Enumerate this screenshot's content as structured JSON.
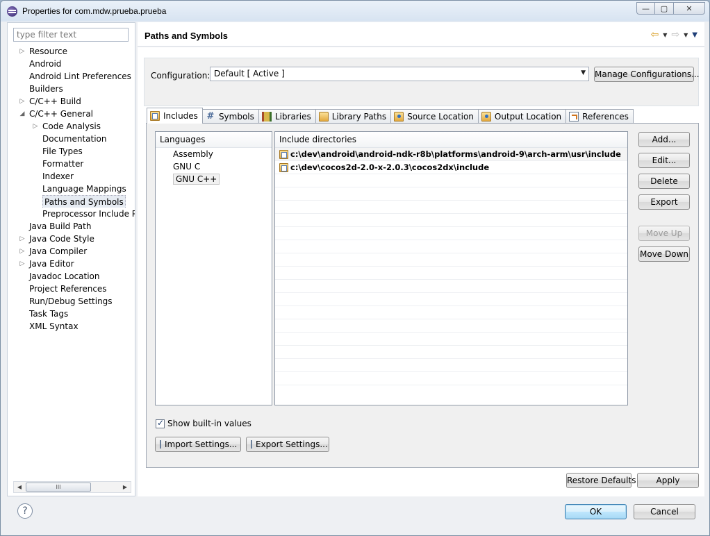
{
  "window": {
    "title": "Properties for com.mdw.prueba.prueba",
    "min_glyph": "—",
    "max_glyph": "▢",
    "close_glyph": "✕"
  },
  "filter": {
    "placeholder": "type filter text"
  },
  "tree": [
    {
      "label": "Resource",
      "level": 0,
      "twisty": "closed"
    },
    {
      "label": "Android",
      "level": 0,
      "twisty": "none"
    },
    {
      "label": "Android Lint Preferences",
      "level": 0,
      "twisty": "none"
    },
    {
      "label": "Builders",
      "level": 0,
      "twisty": "none"
    },
    {
      "label": "C/C++ Build",
      "level": 0,
      "twisty": "closed"
    },
    {
      "label": "C/C++ General",
      "level": 0,
      "twisty": "open"
    },
    {
      "label": "Code Analysis",
      "level": 1,
      "twisty": "closed"
    },
    {
      "label": "Documentation",
      "level": 1,
      "twisty": "none"
    },
    {
      "label": "File Types",
      "level": 1,
      "twisty": "none"
    },
    {
      "label": "Formatter",
      "level": 1,
      "twisty": "none"
    },
    {
      "label": "Indexer",
      "level": 1,
      "twisty": "none"
    },
    {
      "label": "Language Mappings",
      "level": 1,
      "twisty": "none"
    },
    {
      "label": "Paths and Symbols",
      "level": 1,
      "twisty": "none",
      "selected": true
    },
    {
      "label": "Preprocessor Include Pa",
      "level": 1,
      "twisty": "none"
    },
    {
      "label": "Java Build Path",
      "level": 0,
      "twisty": "none"
    },
    {
      "label": "Java Code Style",
      "level": 0,
      "twisty": "closed"
    },
    {
      "label": "Java Compiler",
      "level": 0,
      "twisty": "closed"
    },
    {
      "label": "Java Editor",
      "level": 0,
      "twisty": "closed"
    },
    {
      "label": "Javadoc Location",
      "level": 0,
      "twisty": "none"
    },
    {
      "label": "Project References",
      "level": 0,
      "twisty": "none"
    },
    {
      "label": "Run/Debug Settings",
      "level": 0,
      "twisty": "none"
    },
    {
      "label": "Task Tags",
      "level": 0,
      "twisty": "none"
    },
    {
      "label": "XML Syntax",
      "level": 0,
      "twisty": "none"
    }
  ],
  "scrollbar": {
    "left_arrow": "◀",
    "right_arrow": "▶",
    "grip": "III"
  },
  "page": {
    "title": "Paths and Symbols",
    "back_glyph": "⇦",
    "forward_glyph": "⇨",
    "dropdown_glyph": "▼"
  },
  "config": {
    "label": "Configuration:",
    "value": "Default  [ Active ]",
    "manage_button": "Manage Configurations..."
  },
  "tabs": [
    {
      "label": "Includes",
      "icon": "includes-icon",
      "active": true
    },
    {
      "label": "Symbols",
      "icon": "hash-icon"
    },
    {
      "label": "Libraries",
      "icon": "library-icon"
    },
    {
      "label": "Library Paths",
      "icon": "folder-icon"
    },
    {
      "label": "Source Location",
      "icon": "folder-icon"
    },
    {
      "label": "Output Location",
      "icon": "folder-icon"
    },
    {
      "label": "References",
      "icon": "references-icon"
    }
  ],
  "languages": {
    "header": "Languages",
    "items": [
      "Assembly",
      "GNU C",
      "GNU C++"
    ],
    "selected": "GNU C++"
  },
  "includes": {
    "header": "Include directories",
    "rows": [
      "c:\\dev\\android\\android-ndk-r8b\\platforms\\android-9\\arch-arm\\usr\\include",
      "c:\\dev\\cocos2d-2.0-x-2.0.3\\cocos2dx\\include"
    ]
  },
  "side_buttons": {
    "add": "Add...",
    "edit": "Edit...",
    "delete": "Delete",
    "export": "Export",
    "move_up": "Move Up",
    "move_down": "Move Down"
  },
  "show_builtin": {
    "label": "Show built-in values",
    "checked": true
  },
  "import_settings": "Import Settings...",
  "export_settings": "Export Settings...",
  "restore_defaults": "Restore Defaults",
  "apply": "Apply",
  "ok": "OK",
  "cancel": "Cancel",
  "help_glyph": "?"
}
